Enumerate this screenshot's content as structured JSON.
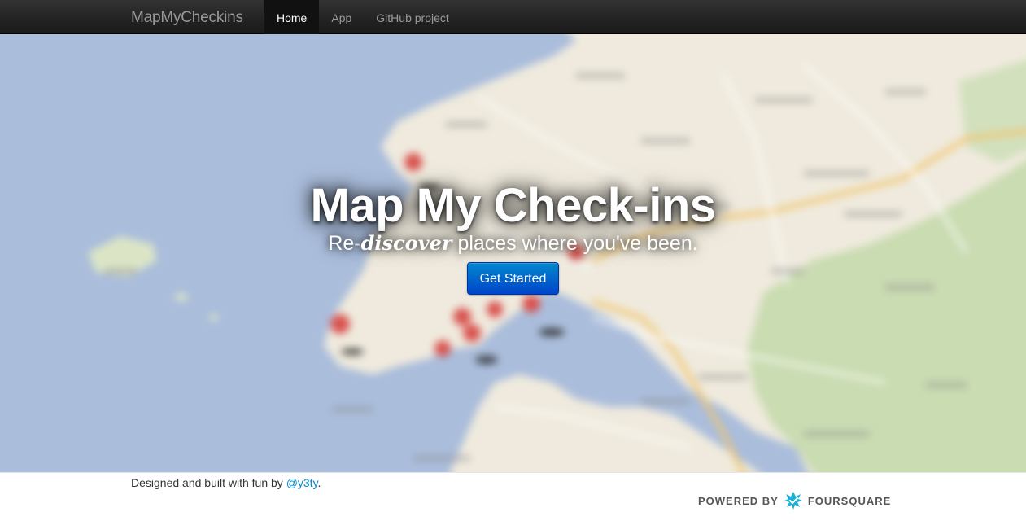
{
  "navbar": {
    "brand": "MapMyCheckins",
    "items": [
      {
        "label": "Home",
        "active": true
      },
      {
        "label": "App",
        "active": false
      },
      {
        "label": "GitHub project",
        "active": false
      }
    ]
  },
  "hero": {
    "title": "Map My Check-ins",
    "subtitle_prefix": "Re-",
    "subtitle_emphasis": "discover",
    "subtitle_suffix": " places where you've been.",
    "cta_label": "Get Started"
  },
  "footer": {
    "credit_prefix": "Designed and built with fun by ",
    "credit_link": "@y3ty",
    "credit_suffix": ".",
    "powered_by": "POWERED BY",
    "provider": "FOURSQUARE"
  },
  "colors": {
    "accent": "#0088cc",
    "button_top": "#0088cc",
    "button_bottom": "#0044cc",
    "navbar": "#222222",
    "sea": "#a9bcd9",
    "land": "#efeadc",
    "forest": "#c9dcb0",
    "pin": "#d9534f",
    "foursquare": "#1bb0d6"
  },
  "icons": {
    "map_pin": "map-pin-icon",
    "foursquare": "foursquare-logo-icon"
  }
}
